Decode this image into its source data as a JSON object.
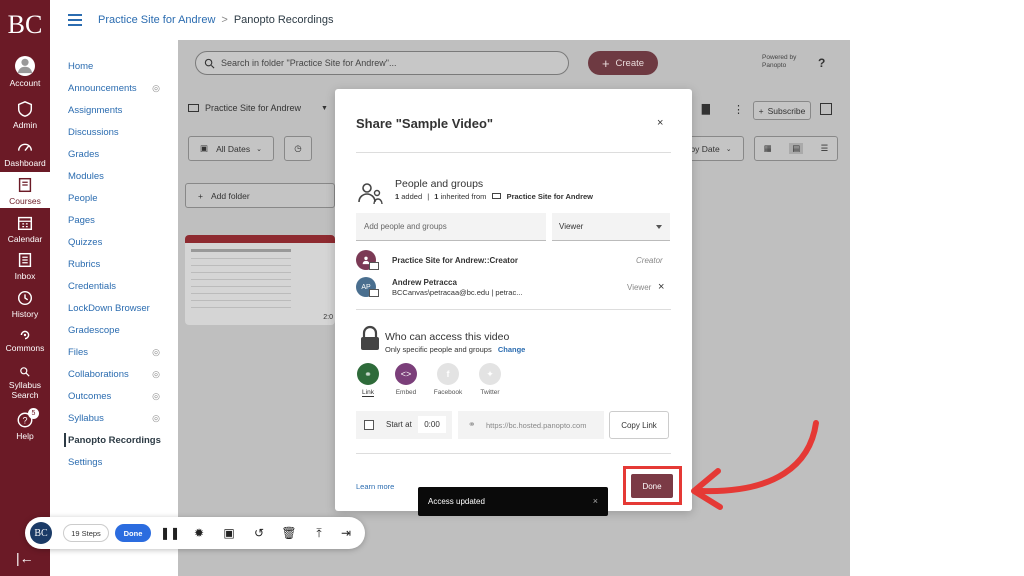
{
  "global_nav": {
    "logo": "BC",
    "items": [
      {
        "label": "Account",
        "icon": "user-icon"
      },
      {
        "label": "Admin",
        "icon": "shield-icon"
      },
      {
        "label": "Dashboard",
        "icon": "gauge-icon"
      },
      {
        "label": "Courses",
        "icon": "book-icon"
      },
      {
        "label": "Calendar",
        "icon": "calendar-icon"
      },
      {
        "label": "Inbox",
        "icon": "inbox-icon"
      },
      {
        "label": "History",
        "icon": "clock-icon"
      },
      {
        "label": "Commons",
        "icon": "commons-icon"
      },
      {
        "label": "Syllabus Search",
        "icon": "search-icon"
      },
      {
        "label": "Help",
        "icon": "help-icon",
        "badge": "5"
      }
    ],
    "collapse": "|←"
  },
  "breadcrumb": {
    "course": "Practice Site for Andrew",
    "separator": ">",
    "current": "Panopto Recordings"
  },
  "course_nav": {
    "items": [
      "Home",
      "Announcements",
      "Assignments",
      "Discussions",
      "Grades",
      "Modules",
      "People",
      "Pages",
      "Quizzes",
      "Rubrics",
      "Credentials",
      "LockDown Browser",
      "Gradescope",
      "Files",
      "Collaborations",
      "Outcomes",
      "Syllabus",
      "Panopto Recordings",
      "Settings"
    ]
  },
  "panopto": {
    "search_placeholder": "Search in folder \"Practice Site for Andrew\"...",
    "create": "Create",
    "powered_by": "Powered by",
    "powered_brand": "Panopto",
    "help": "?",
    "folder": "Practice Site for Andrew",
    "subscribe": "Subscribe",
    "all_dates": "All Dates",
    "sort": "by Date",
    "add_folder": "Add folder",
    "thumb_time": "2:0"
  },
  "modal": {
    "title": "Share \"Sample Video\"",
    "close": "×",
    "people": {
      "title": "People and groups",
      "added_count": "1",
      "added_label": "added",
      "sep": "|",
      "inherited_count": "1",
      "inherited_label": "inherited from",
      "inherited_from": "Practice Site for Andrew",
      "input_placeholder": "Add people and groups",
      "role_select": "Viewer",
      "entries": [
        {
          "name": "Practice Site for Andrew::Creator",
          "role": "Creator",
          "avatar": ""
        },
        {
          "name": "Andrew Petracca",
          "email": "BCCanvas\\petracaa@bc.edu | petrac...",
          "role": "Viewer",
          "avatar": "AP",
          "remove": "×"
        }
      ]
    },
    "access": {
      "title": "Who can access this video",
      "sub": "Only specific people and groups",
      "change": "Change"
    },
    "share_options": [
      {
        "label": "Link",
        "color": "#2e6b3a"
      },
      {
        "label": "Embed",
        "color": "#7b3f7a"
      },
      {
        "label": "Facebook",
        "color": "#e3e3e3"
      },
      {
        "label": "Twitter",
        "color": "#e3e3e3"
      }
    ],
    "start_at_label": "Start at",
    "start_at_value": "0:00",
    "link_url": "https://bc.hosted.panopto.com",
    "copy_link": "Copy Link",
    "learn_more": "Learn more",
    "done": "Done"
  },
  "toast": {
    "message": "Access updated",
    "close": "×"
  },
  "recorder": {
    "logo": "BC",
    "steps": "19 Steps",
    "done": "Done"
  },
  "colors": {
    "brand": "#6b1a26",
    "link": "#2b6cb0",
    "highlight": "#e53935",
    "done_button": "#7b3a45"
  }
}
